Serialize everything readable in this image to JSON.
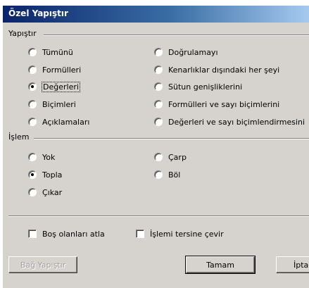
{
  "window": {
    "title": "Özel Yapıştır"
  },
  "paste_group": {
    "label": "Yapıştır",
    "left_options": [
      {
        "label": "Tümünü",
        "checked": false
      },
      {
        "label": "Formülleri",
        "checked": false
      },
      {
        "label": "Değerleri",
        "checked": true
      },
      {
        "label": "Biçimleri",
        "checked": false
      },
      {
        "label": "Açıklamaları",
        "checked": false
      }
    ],
    "right_options": [
      {
        "label": "Doğrulamayı",
        "checked": false
      },
      {
        "label": "Kenarlıklar dışındaki her şeyi",
        "checked": false
      },
      {
        "label": "Sütun genişliklerini",
        "checked": false
      },
      {
        "label": "Formülleri ve sayı biçimlerini",
        "checked": false
      },
      {
        "label": "Değerleri ve sayı biçimlendirmesini",
        "checked": false
      }
    ]
  },
  "operation_group": {
    "label": "İşlem",
    "left_options": [
      {
        "label": "Yok",
        "checked": false
      },
      {
        "label": "Topla",
        "checked": true
      },
      {
        "label": "Çıkar",
        "checked": false
      }
    ],
    "right_options": [
      {
        "label": "Çarp",
        "checked": false
      },
      {
        "label": "Böl",
        "checked": false
      }
    ]
  },
  "checkboxes": {
    "skip_blanks": {
      "label": "Boş olanları atla",
      "checked": false
    },
    "transpose": {
      "label": "İşlemi tersine çevir",
      "checked": false
    }
  },
  "buttons": {
    "paste_link": "Bağ Yapıştır",
    "ok": "Tamam",
    "cancel": "İptal"
  }
}
